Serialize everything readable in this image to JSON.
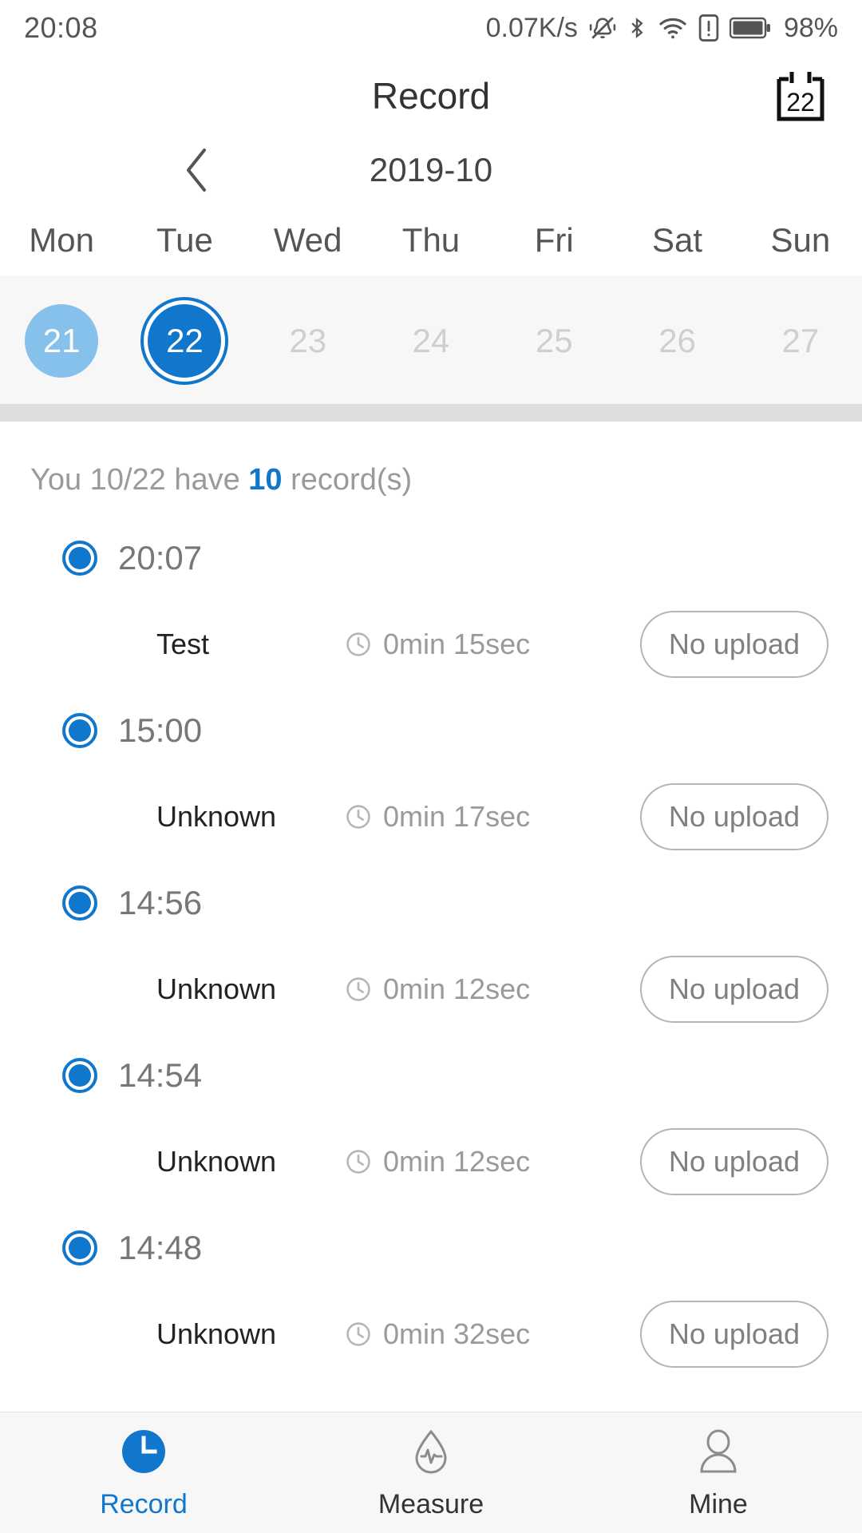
{
  "status_bar": {
    "time": "20:08",
    "network_speed": "0.07K/s",
    "battery_percent": "98%",
    "icons": [
      "vibrate-off-icon",
      "bluetooth-icon",
      "wifi-icon",
      "sim-alert-icon",
      "battery-icon"
    ]
  },
  "header": {
    "title": "Record",
    "calendar_button_day": "22"
  },
  "calendar": {
    "prev_label": "‹",
    "month": "2019-10",
    "weekdays": [
      "Mon",
      "Tue",
      "Wed",
      "Thu",
      "Fri",
      "Sat",
      "Sun"
    ],
    "days": [
      {
        "num": "21",
        "state": "has-record"
      },
      {
        "num": "22",
        "state": "selected"
      },
      {
        "num": "23",
        "state": "disabled"
      },
      {
        "num": "24",
        "state": "disabled"
      },
      {
        "num": "25",
        "state": "disabled"
      },
      {
        "num": "26",
        "state": "disabled"
      },
      {
        "num": "27",
        "state": "disabled"
      }
    ]
  },
  "summary": {
    "prefix": "You 10/22 have ",
    "count": "10",
    "suffix": " record(s)"
  },
  "records": [
    {
      "time": "20:07",
      "name": "Test",
      "duration": "0min 15sec",
      "upload_status": "No upload"
    },
    {
      "time": "15:00",
      "name": "Unknown",
      "duration": "0min 17sec",
      "upload_status": "No upload"
    },
    {
      "time": "14:56",
      "name": "Unknown",
      "duration": "0min 12sec",
      "upload_status": "No upload"
    },
    {
      "time": "14:54",
      "name": "Unknown",
      "duration": "0min 12sec",
      "upload_status": "No upload"
    },
    {
      "time": "14:48",
      "name": "Unknown",
      "duration": "0min 32sec",
      "upload_status": "No upload"
    }
  ],
  "bottom_nav": {
    "items": [
      {
        "label": "Record",
        "icon": "clock-icon",
        "active": true
      },
      {
        "label": "Measure",
        "icon": "droplet-pulse-icon",
        "active": false
      },
      {
        "label": "Mine",
        "icon": "person-icon",
        "active": false
      }
    ]
  },
  "colors": {
    "accent": "#1177cc",
    "accent_light": "#85c1ea",
    "muted": "#9a9a9a",
    "strip_bg": "#f7f7f7"
  }
}
